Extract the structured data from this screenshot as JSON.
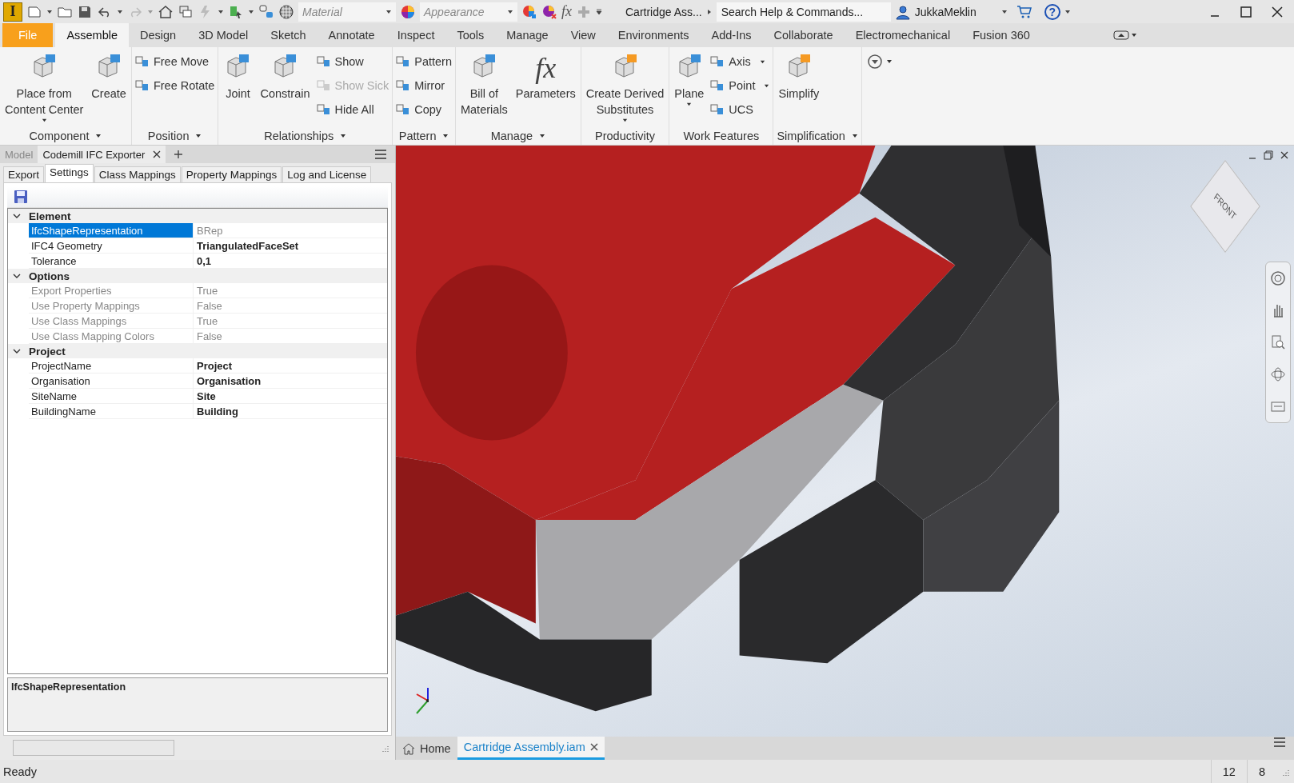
{
  "app": {
    "logo": "I",
    "material_placeholder": "Material",
    "appearance_placeholder": "Appearance",
    "formula_glyph": "fx",
    "document_title": "Cartridge Ass...",
    "search_placeholder": "Search Help & Commands...",
    "user": "JukkaMeklin",
    "help_glyph": "?"
  },
  "ribbon_tabs": [
    {
      "label": "File",
      "kind": "file",
      "selected": false
    },
    {
      "label": "Assemble",
      "kind": "tab",
      "selected": true
    },
    {
      "label": "Design",
      "kind": "tab",
      "selected": false
    },
    {
      "label": "3D Model",
      "kind": "tab",
      "selected": false
    },
    {
      "label": "Sketch",
      "kind": "tab",
      "selected": false
    },
    {
      "label": "Annotate",
      "kind": "tab",
      "selected": false
    },
    {
      "label": "Inspect",
      "kind": "tab",
      "selected": false
    },
    {
      "label": "Tools",
      "kind": "tab",
      "selected": false
    },
    {
      "label": "Manage",
      "kind": "tab",
      "selected": false
    },
    {
      "label": "View",
      "kind": "tab",
      "selected": false
    },
    {
      "label": "Environments",
      "kind": "tab",
      "selected": false
    },
    {
      "label": "Add-Ins",
      "kind": "tab",
      "selected": false
    },
    {
      "label": "Collaborate",
      "kind": "tab",
      "selected": false
    },
    {
      "label": "Electromechanical",
      "kind": "tab",
      "selected": false
    },
    {
      "label": "Fusion 360",
      "kind": "tab",
      "selected": false
    }
  ],
  "ribbon_panels": [
    {
      "title": "Component",
      "has_menu": true,
      "columns": [
        {
          "kind": "large",
          "lines": [
            "Place from",
            "Content Center"
          ],
          "dropdown": true
        },
        {
          "kind": "large",
          "lines": [
            "Create"
          ],
          "dropdown": false
        }
      ]
    },
    {
      "title": "Position",
      "has_menu": true,
      "columns": [
        {
          "kind": "small",
          "items": [
            {
              "label": "Free Move",
              "disabled": false,
              "dropdown": false
            },
            {
              "label": "Free Rotate",
              "disabled": false,
              "dropdown": false
            }
          ]
        }
      ]
    },
    {
      "title": "Relationships",
      "has_menu": true,
      "columns": [
        {
          "kind": "large",
          "lines": [
            "Joint"
          ],
          "dropdown": false
        },
        {
          "kind": "large",
          "lines": [
            "Constrain"
          ],
          "dropdown": false
        },
        {
          "kind": "small",
          "items": [
            {
              "label": "Show",
              "disabled": false,
              "dropdown": false
            },
            {
              "label": "Show Sick",
              "disabled": true,
              "dropdown": false
            },
            {
              "label": "Hide All",
              "disabled": false,
              "dropdown": false
            }
          ]
        }
      ]
    },
    {
      "title": "Pattern",
      "has_menu": true,
      "columns": [
        {
          "kind": "small",
          "items": [
            {
              "label": "Pattern",
              "disabled": false,
              "dropdown": false
            },
            {
              "label": "Mirror",
              "disabled": false,
              "dropdown": false
            },
            {
              "label": "Copy",
              "disabled": false,
              "dropdown": false
            }
          ]
        }
      ]
    },
    {
      "title": "Manage",
      "has_menu": true,
      "columns": [
        {
          "kind": "large",
          "lines": [
            "Bill of",
            "Materials"
          ],
          "dropdown": false
        },
        {
          "kind": "glyph",
          "glyph": "fx",
          "lines": [
            "Parameters"
          ],
          "dropdown": false
        }
      ]
    },
    {
      "title": "Productivity",
      "has_menu": false,
      "columns": [
        {
          "kind": "large",
          "lines": [
            "Create Derived",
            "Substitutes"
          ],
          "dropdown": true
        }
      ]
    },
    {
      "title": "Work Features",
      "has_menu": false,
      "columns": [
        {
          "kind": "large",
          "lines": [
            "Plane"
          ],
          "dropdown": true
        },
        {
          "kind": "small",
          "items": [
            {
              "label": "Axis",
              "disabled": false,
              "dropdown": true
            },
            {
              "label": "Point",
              "disabled": false,
              "dropdown": true
            },
            {
              "label": "UCS",
              "disabled": false,
              "dropdown": false
            }
          ]
        }
      ]
    },
    {
      "title": "Simplification",
      "has_menu": true,
      "columns": [
        {
          "kind": "large",
          "lines": [
            "Simplify"
          ],
          "dropdown": false
        }
      ]
    }
  ],
  "panel": {
    "tabs": [
      {
        "label": "Model",
        "selected": false,
        "closable": false
      },
      {
        "label": "Codemill IFC Exporter",
        "selected": true,
        "closable": true
      }
    ],
    "sub_tabs": [
      {
        "label": "Export",
        "selected": false
      },
      {
        "label": "Settings",
        "selected": true
      },
      {
        "label": "Class Mappings",
        "selected": false
      },
      {
        "label": "Property Mappings",
        "selected": false
      },
      {
        "label": "Log and License",
        "selected": false
      }
    ],
    "property_grid": [
      {
        "name": "Element",
        "expanded": true,
        "properties": [
          {
            "name": "IfcShapeRepresentation",
            "value": "BRep",
            "selected": true,
            "disabled": false,
            "modified": false
          },
          {
            "name": "IFC4 Geometry",
            "value": "TriangulatedFaceSet",
            "selected": false,
            "disabled": false,
            "modified": true
          },
          {
            "name": "Tolerance",
            "value": "0,1",
            "selected": false,
            "disabled": false,
            "modified": true
          }
        ]
      },
      {
        "name": "Options",
        "expanded": true,
        "properties": [
          {
            "name": "Export Properties",
            "value": "True",
            "selected": false,
            "disabled": true,
            "modified": false
          },
          {
            "name": "Use Property Mappings",
            "value": "False",
            "selected": false,
            "disabled": true,
            "modified": false
          },
          {
            "name": "Use Class Mappings",
            "value": "True",
            "selected": false,
            "disabled": true,
            "modified": false
          },
          {
            "name": "Use Class Mapping Colors",
            "value": "False",
            "selected": false,
            "disabled": true,
            "modified": false
          }
        ]
      },
      {
        "name": "Project",
        "expanded": true,
        "properties": [
          {
            "name": "ProjectName",
            "value": "Project",
            "selected": false,
            "disabled": false,
            "modified": true
          },
          {
            "name": "Organisation",
            "value": "Organisation",
            "selected": false,
            "disabled": false,
            "modified": true
          },
          {
            "name": "SiteName",
            "value": "Site",
            "selected": false,
            "disabled": false,
            "modified": true
          },
          {
            "name": "BuildingName",
            "value": "Building",
            "selected": false,
            "disabled": false,
            "modified": true
          }
        ]
      }
    ],
    "description": "IfcShapeRepresentation"
  },
  "viewport": {
    "view_cube_label": "FRONT"
  },
  "document_tabs": [
    {
      "label": "Home",
      "kind": "home",
      "selected": false
    },
    {
      "label": "Cartridge Assembly.iam",
      "kind": "document",
      "selected": true
    }
  ],
  "status_bar": {
    "message": "Ready",
    "fields": [
      "12",
      "8"
    ]
  }
}
